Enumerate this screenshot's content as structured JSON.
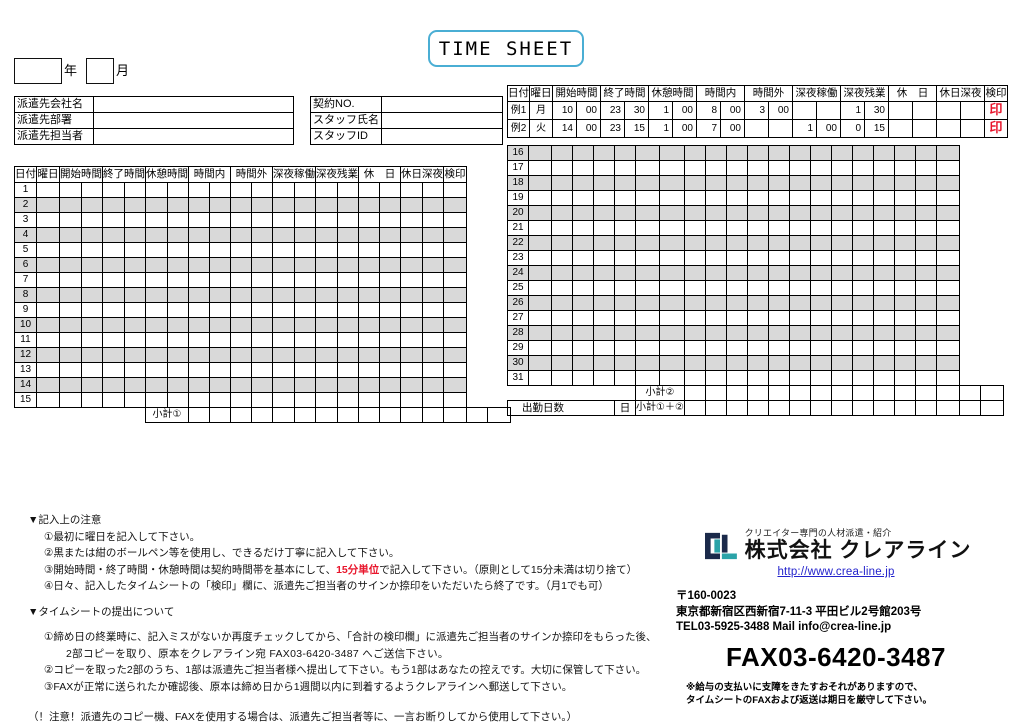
{
  "title": "TIME  SHEET",
  "date_fields": {
    "year_label": "年",
    "month_label": "月",
    "year_value": "",
    "month_value": ""
  },
  "info_left": [
    {
      "label": "派遣先会社名",
      "value": ""
    },
    {
      "label": "派遣先部署",
      "value": ""
    },
    {
      "label": "派遣先担当者",
      "value": ""
    }
  ],
  "info_right": [
    {
      "label": "契約NO.",
      "value": ""
    },
    {
      "label": "スタッフ氏名",
      "value": ""
    },
    {
      "label": "スタッフID",
      "value": ""
    }
  ],
  "columns": [
    "日付",
    "曜日",
    "開始時間",
    "終了時間",
    "休憩時間",
    "時間内",
    "時間外",
    "深夜稼働",
    "深夜残業",
    "休　日",
    "休日深夜",
    "検印"
  ],
  "example_rows": [
    {
      "day": "例1",
      "weekday": "月",
      "start_h": "10",
      "start_m": "00",
      "end_h": "23",
      "end_m": "30",
      "break_h": "1",
      "break_m": "00",
      "in_h": "8",
      "in_m": "00",
      "ot_h": "3",
      "ot_m": "00",
      "night_h": "",
      "night_m": "",
      "night_ot_h": "1",
      "night_ot_m": "30",
      "holiday_h": "",
      "holiday_m": "",
      "hol_night_h": "",
      "hol_night_m": "",
      "seal": "印"
    },
    {
      "day": "例2",
      "weekday": "火",
      "start_h": "14",
      "start_m": "00",
      "end_h": "23",
      "end_m": "15",
      "break_h": "1",
      "break_m": "00",
      "in_h": "7",
      "in_m": "00",
      "ot_h": "",
      "ot_m": "",
      "night_h": "1",
      "night_m": "00",
      "night_ot_h": "0",
      "night_ot_m": "15",
      "holiday_h": "",
      "holiday_m": "",
      "hol_night_h": "",
      "hol_night_m": "",
      "seal": "印"
    }
  ],
  "days_left": [
    "1",
    "2",
    "3",
    "4",
    "5",
    "6",
    "7",
    "8",
    "9",
    "10",
    "11",
    "12",
    "13",
    "14",
    "15"
  ],
  "days_right": [
    "16",
    "17",
    "18",
    "19",
    "20",
    "21",
    "22",
    "23",
    "24",
    "25",
    "26",
    "27",
    "28",
    "29",
    "30",
    "31"
  ],
  "totals": {
    "subtotal1": "小計①",
    "subtotal2": "小計②",
    "grand": "小計①＋②",
    "workdays_label": "出勤日数",
    "workdays_unit": "日",
    "workdays_value": ""
  },
  "notes": {
    "section1_heading": "▼記入上の注意",
    "section1_items": [
      "①最初に曜日を記入して下さい。",
      "②黒または紺のボールペン等を使用し、できるだけ丁寧に記入して下さい。",
      "④日々、記入したタイムシートの「検印」欄に、派遣先ご担当者のサインか捺印をいただいたら終了です。（月1でも可）"
    ],
    "item3_pre": "③開始時間・終了時間・休憩時間は契約時間帯を基本にして、",
    "item3_red": "15分単位",
    "item3_post": "で記入して下さい。（原則として15分未満は切り捨て）",
    "section2_heading": "▼タイムシートの提出について",
    "section2_item1_line1": "①締め日の終業時に、記入ミスがないか再度チェックしてから、「合計の検印欄」に派遣先ご担当者のサインか捺印をもらった後、",
    "section2_item1_line2": "2部コピーを取り、原本をクレアライン宛  FAX03-6420-3487  へご送信下さい。",
    "section2_item2": "②コピーを取った2部のうち、1部は派遣先ご担当者様へ提出して下さい。もう1部はあなたの控えです。大切に保管して下さい。",
    "section2_item3": "③FAXが正常に送られたか確認後、原本は締め日から1週間以内に到着するようクレアラインへ郵送して下さい。",
    "caution": "（！注意！派遣先のコピー機、FAXを使用する場合は、派遣先ご担当者等に、一言お断りしてから使用して下さい。）"
  },
  "company": {
    "tagline": "クリエイター専門の人材派遣・紹介",
    "name": "株式会社 クレアライン",
    "url": "http://www.crea-line.jp",
    "zip": "〒160-0023",
    "address": "東京都新宿区西新宿7-11-3 平田ビル2号館203号",
    "tel_mail": "TEL03-5925-3488      Mail  info@crea-line.jp",
    "fax": "FAX03-6420-3487",
    "warning_line1": "※給与の支払いに支障をきたすおそれがありますので、",
    "warning_line2": "タイムシートのFAXおよび返送は期日を厳守して下さい。"
  },
  "colors": {
    "title_border": "#4aaed4",
    "accent_red": "#e8162c",
    "logo_teal": "#2aa3a8",
    "logo_navy": "#1b2a4a",
    "shade": "#d9d9d9"
  }
}
